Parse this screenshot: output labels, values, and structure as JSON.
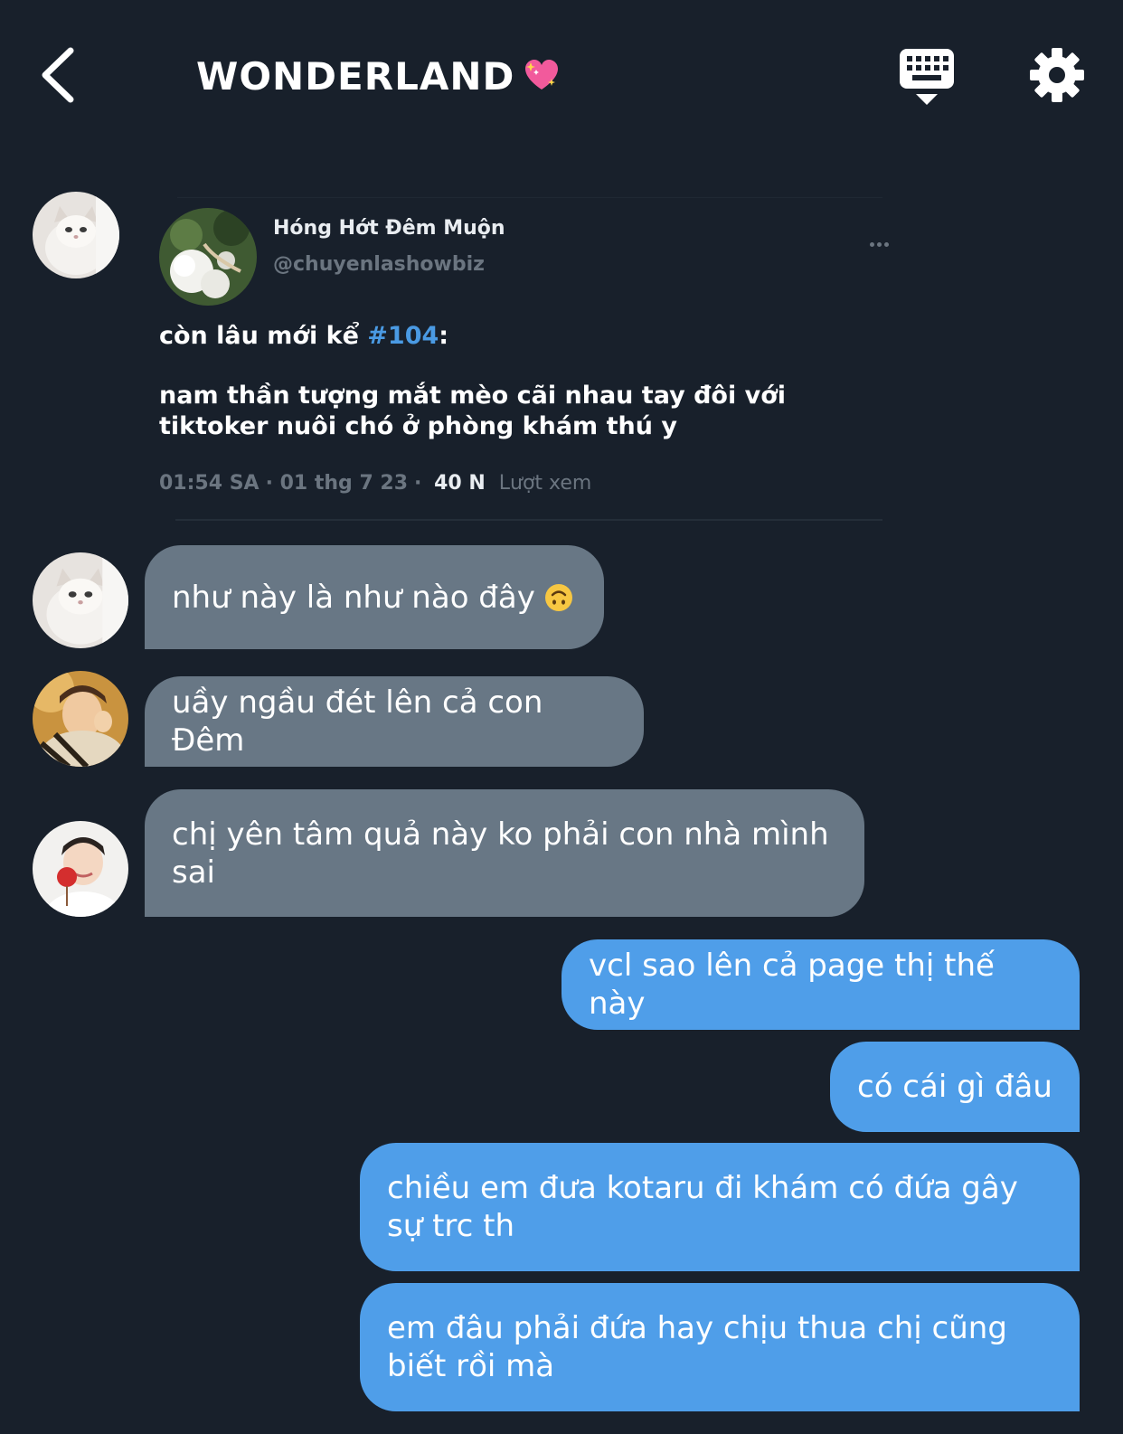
{
  "header": {
    "title": "WONDERLAND",
    "title_emoji": "sparkling-heart",
    "back_icon": "chevron-left-icon",
    "keyboard_icon": "keyboard-icon",
    "settings_icon": "gear-icon"
  },
  "shared_post": {
    "author_name": "Hóng Hớt Đêm Muộn",
    "author_handle": "@chuyenlashowbiz",
    "line1_prefix": "còn lâu mới kể ",
    "hashtag": "#104",
    "line1_suffix": ":",
    "body": "nam thần tượng mắt mèo cãi nhau tay đôi với tiktoker nuôi chó ở phòng khám thú y",
    "time": "01:54 SA",
    "date": "01 thg 7 23",
    "views_count": "40 N",
    "views_label": "Lượt xem"
  },
  "messages": [
    {
      "side": "in",
      "avatar": "cat",
      "text": "như này là như nào đây",
      "emoji": "upside-down-face"
    },
    {
      "side": "in",
      "avatar": "boy-fur",
      "text": "uầy ngầu đét lên cả con Đêm"
    },
    {
      "side": "in",
      "avatar": "boy-lollipop",
      "text": "chị yên tâm quả này ko phải con nhà mình sai"
    },
    {
      "side": "out",
      "text": "vcl sao lên cả page thị thế này"
    },
    {
      "side": "out",
      "text": "có cái gì đâu"
    },
    {
      "side": "out",
      "text": "chiều em đưa kotaru đi khám có đứa gây sự trc th"
    },
    {
      "side": "out",
      "text": "em đâu phải đứa hay chịu thua chị cũng biết rồi mà"
    }
  ],
  "colors": {
    "background": "#18202b",
    "incoming_bubble": "#687785",
    "outgoing_bubble": "#4f9ee9",
    "hashtag": "#4a9ae3",
    "muted_text": "#6b7580"
  }
}
